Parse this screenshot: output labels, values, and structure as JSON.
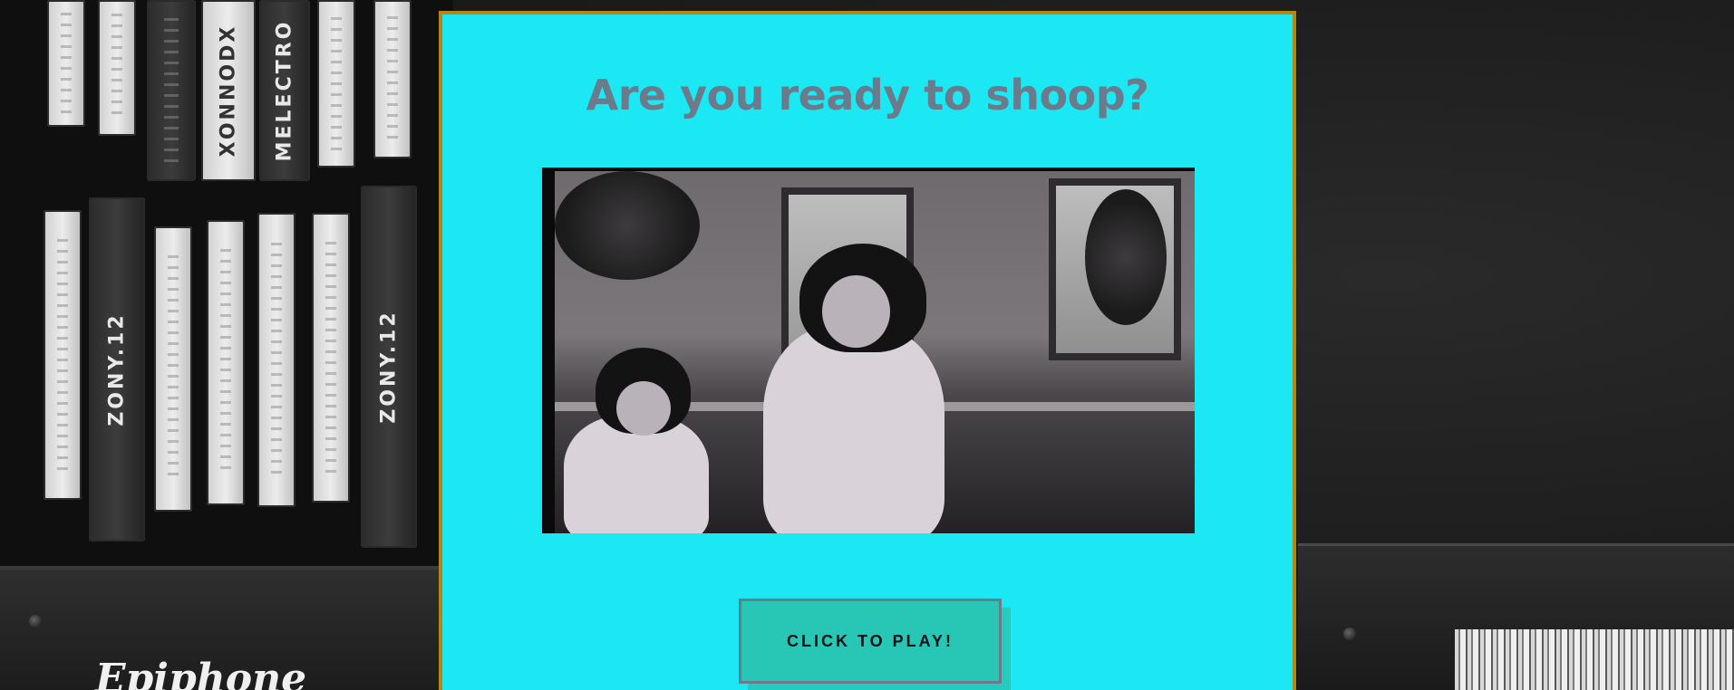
{
  "modal": {
    "title": "Are you ready to shoop?",
    "play_button_label": "CLICK TO PLAY!",
    "video_description": "black-and-white video clip"
  },
  "background": {
    "tape_labels": [
      "ZONY.12",
      "ZONY.12",
      "MELECTRO",
      "XONNODX"
    ],
    "amp_logo": "Epiphone"
  },
  "colors": {
    "modal_background": "#1be8f3",
    "modal_border": "#b88412",
    "title_text": "#6b7b8c",
    "button_background": "#28c6b4",
    "button_border": "#6c7b8b"
  }
}
